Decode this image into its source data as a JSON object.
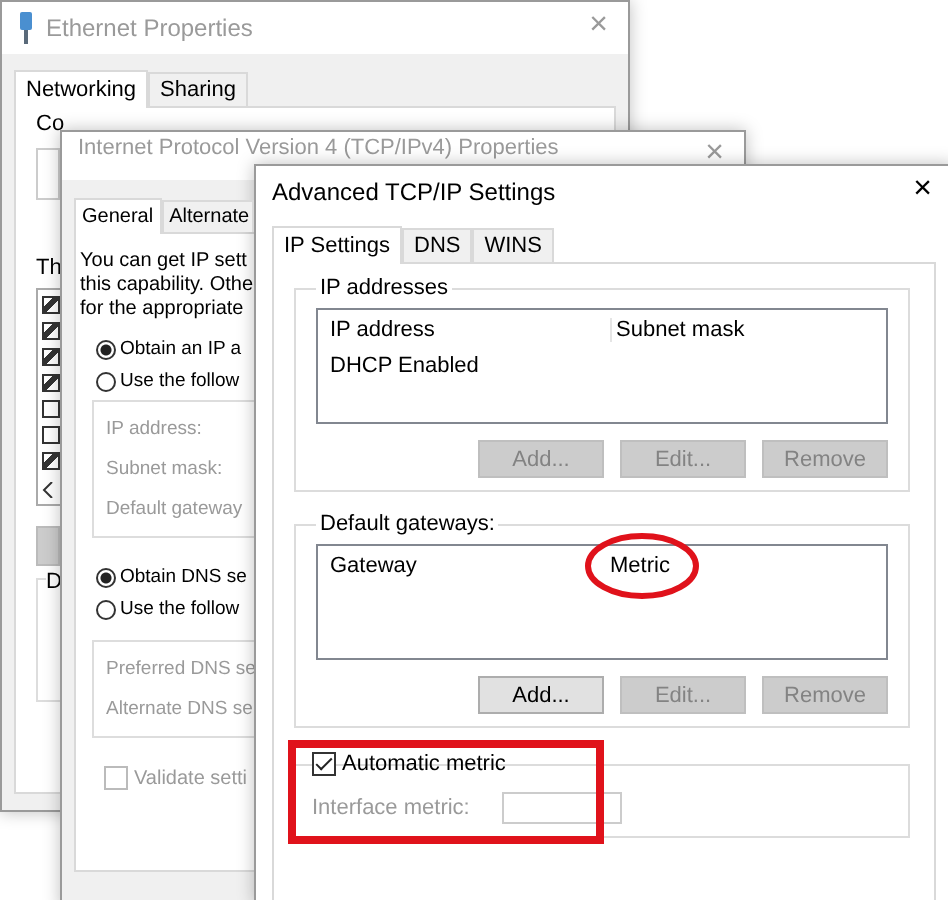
{
  "ethernet_window": {
    "title": "Ethernet Properties",
    "close": "×",
    "tabs": [
      {
        "label": "Networking",
        "selected": true
      },
      {
        "label": "Sharing",
        "selected": false
      }
    ],
    "connect_label": "Co",
    "items_label": "Th",
    "items": [
      {
        "checked": true
      },
      {
        "checked": true
      },
      {
        "checked": true
      },
      {
        "checked": true
      },
      {
        "checked": false
      },
      {
        "checked": false
      },
      {
        "checked": true
      }
    ],
    "description_label": "D"
  },
  "ipv4_window": {
    "title": "Internet Protocol Version 4 (TCP/IPv4) Properties",
    "close": "×",
    "tabs": [
      {
        "label": "General",
        "selected": true
      },
      {
        "label": "Alternate",
        "selected": false
      }
    ],
    "intro": [
      "You can get IP sett",
      "this capability. Othe",
      "for the appropriate"
    ],
    "ip_options": [
      {
        "label": "Obtain an IP a",
        "selected": true
      },
      {
        "label": "Use the follow",
        "selected": false
      }
    ],
    "ip_fields": [
      "IP address:",
      "Subnet mask:",
      "Default gateway"
    ],
    "dns_options": [
      {
        "label": "Obtain DNS se",
        "selected": true
      },
      {
        "label": "Use the follow",
        "selected": false
      }
    ],
    "dns_fields": [
      "Preferred DNS se",
      "Alternate DNS se"
    ],
    "validate": {
      "label": "Validate setti",
      "checked": false,
      "disabled": true
    }
  },
  "advanced_window": {
    "title": "Advanced TCP/IP Settings",
    "close": "×",
    "tabs": [
      {
        "label": "IP Settings",
        "selected": true
      },
      {
        "label": "DNS",
        "selected": false
      },
      {
        "label": "WINS",
        "selected": false
      }
    ],
    "ip_addresses": {
      "legend": "IP addresses",
      "columns": [
        "IP address",
        "Subnet mask"
      ],
      "rows": [
        [
          "DHCP Enabled"
        ]
      ],
      "buttons": [
        {
          "label": "Add...",
          "disabled": true
        },
        {
          "label": "Edit...",
          "disabled": true
        },
        {
          "label": "Remove",
          "disabled": true
        }
      ]
    },
    "gateways": {
      "legend": "Default gateways:",
      "columns": [
        "Gateway",
        "Metric"
      ],
      "buttons": [
        {
          "label": "Add...",
          "disabled": false
        },
        {
          "label": "Edit...",
          "disabled": true
        },
        {
          "label": "Remove",
          "disabled": true
        }
      ]
    },
    "automatic_metric": {
      "label": "Automatic metric",
      "checked": true
    },
    "interface_metric": {
      "label": "Interface metric:",
      "disabled": true
    }
  }
}
